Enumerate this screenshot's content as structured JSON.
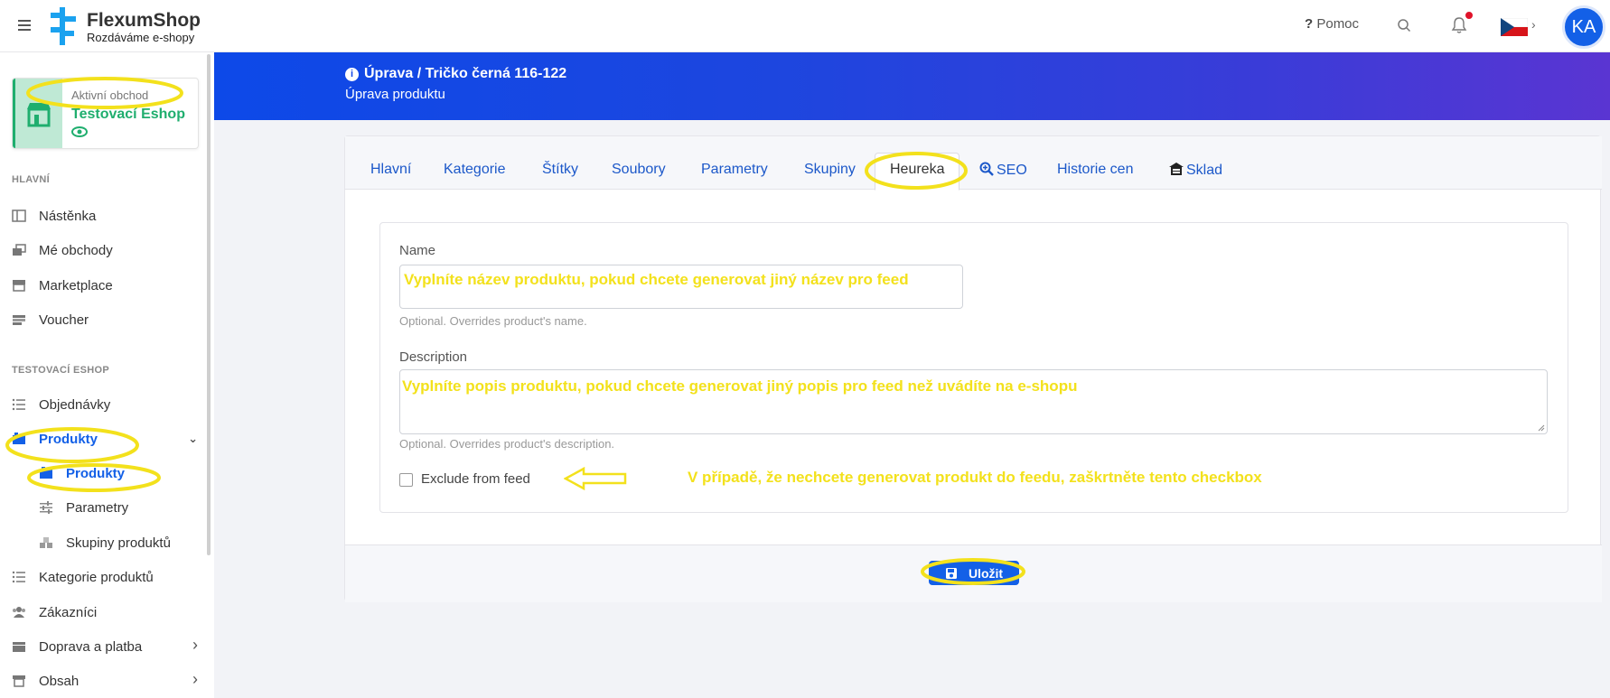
{
  "header": {
    "brand_name": "FlexumShop",
    "brand_tagline": "Rozdáváme e-shopy",
    "help_label": "Pomoc",
    "avatar_initials": "KA",
    "accent_color": "#1360e7"
  },
  "sidebar": {
    "active_shop_label": "Aktivní obchod",
    "active_shop_name": "Testovací Eshop",
    "section_main": "HLAVNÍ",
    "items_main": [
      {
        "label": "Nástěnka"
      },
      {
        "label": "Mé obchody"
      },
      {
        "label": "Marketplace"
      },
      {
        "label": "Voucher"
      }
    ],
    "section_shop": "TESTOVACÍ ESHOP",
    "items_shop": [
      {
        "label": "Objednávky"
      },
      {
        "label": "Produkty"
      },
      {
        "label": "Produkty"
      },
      {
        "label": "Parametry"
      },
      {
        "label": "Skupiny produktů"
      },
      {
        "label": "Kategorie produktů"
      },
      {
        "label": "Zákazníci"
      },
      {
        "label": "Doprava a platba"
      },
      {
        "label": "Obsah"
      }
    ]
  },
  "banner": {
    "title": "Úprava / Tričko černá 116-122",
    "subtitle": "Úprava produktu"
  },
  "tabs": [
    {
      "label": "Hlavní"
    },
    {
      "label": "Kategorie"
    },
    {
      "label": "Štítky"
    },
    {
      "label": "Soubory"
    },
    {
      "label": "Parametry"
    },
    {
      "label": "Skupiny"
    },
    {
      "label": "Heureka"
    },
    {
      "label": "SEO"
    },
    {
      "label": "Historie cen"
    },
    {
      "label": "Sklad"
    }
  ],
  "form": {
    "name_label": "Name",
    "name_value": "Vyplníte název produktu, pokud chcete generovat jiný název pro feed",
    "name_hint": "Optional. Overrides product's name.",
    "description_label": "Description",
    "description_value": "Vyplníte popis produktu, pokud chcete generovat jiný popis pro feed než uvádíte na e-shopu",
    "description_hint": "Optional. Overrides product's description.",
    "exclude_label": "Exclude from feed",
    "exclude_checked": false,
    "exclude_annotation": "V případě, že nechcete generovat produkt do feedu, zaškrtněte tento checkbox"
  },
  "footer": {
    "save_label": "Uložit"
  }
}
